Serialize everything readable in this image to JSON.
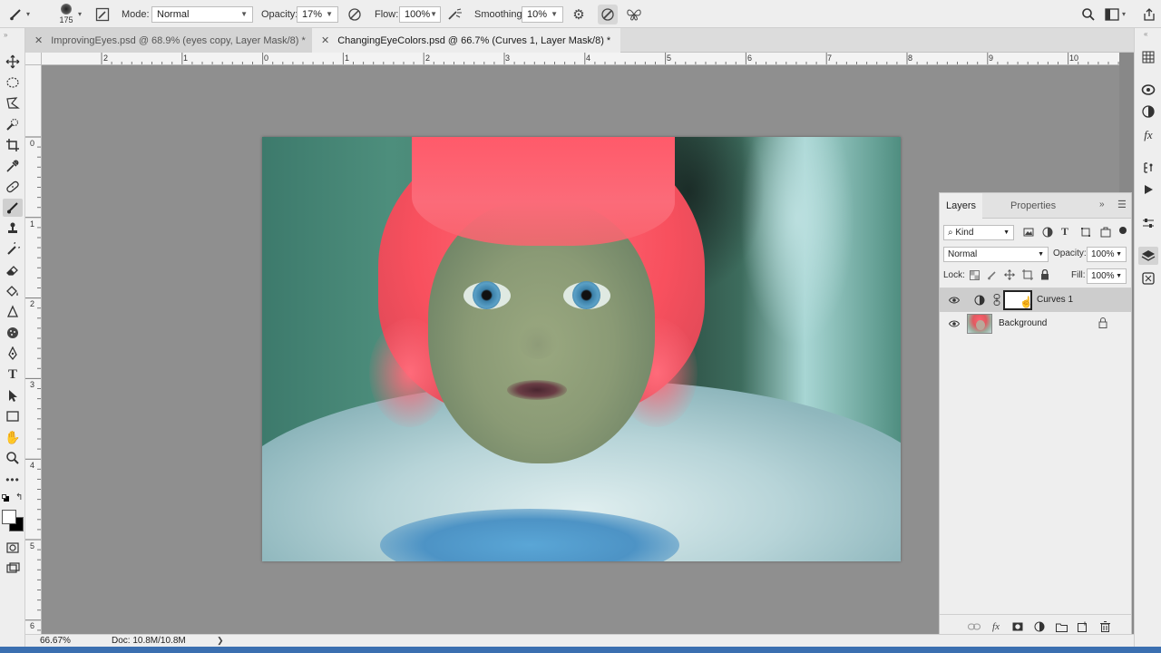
{
  "options_bar": {
    "brush_size": "175",
    "mode_label": "Mode:",
    "mode_value": "Normal",
    "opacity_label": "Opacity:",
    "opacity_value": "17%",
    "flow_label": "Flow:",
    "flow_value": "100%",
    "smoothing_label": "Smoothing:",
    "smoothing_value": "10%"
  },
  "tabs": [
    {
      "label": "ImprovingEyes.psd @ 68.9% (eyes copy, Layer Mask/8) *",
      "active": false
    },
    {
      "label": "ChangingEyeColors.psd @ 66.7% (Curves 1, Layer Mask/8) *",
      "active": true
    }
  ],
  "rulers": {
    "horizontal": [
      "2",
      "1",
      "0",
      "1",
      "2",
      "3",
      "4",
      "5",
      "6",
      "7",
      "8",
      "9",
      "10"
    ],
    "vertical": [
      "0",
      "1",
      "2",
      "3",
      "4",
      "5",
      "6"
    ]
  },
  "status": {
    "zoom": "66.67%",
    "doc": "Doc: 10.8M/10.8M"
  },
  "layers_panel": {
    "tab_layers": "Layers",
    "tab_properties": "Properties",
    "kind_label": "Kind",
    "blend_mode": "Normal",
    "opacity_label": "Opacity:",
    "opacity_value": "100%",
    "lock_label": "Lock:",
    "fill_label": "Fill:",
    "fill_value": "100%",
    "layers": [
      {
        "name": "Curves 1",
        "selected": true
      },
      {
        "name": "Background",
        "selected": false
      }
    ]
  }
}
